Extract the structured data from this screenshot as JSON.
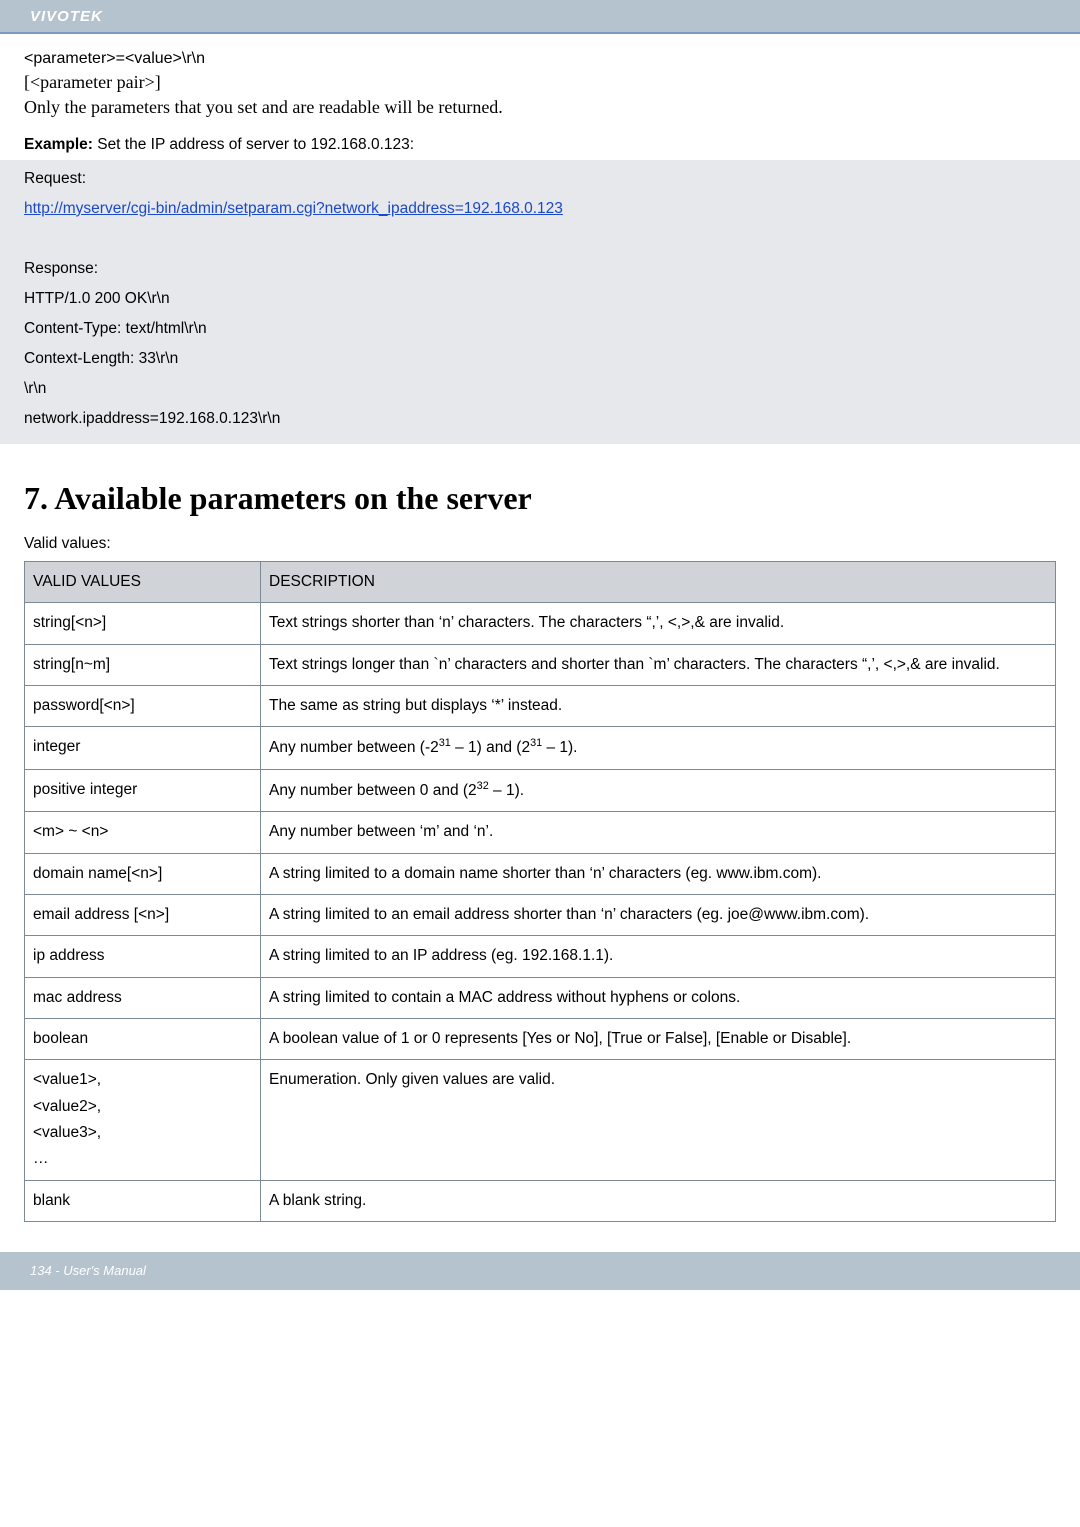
{
  "header": {
    "brand": "VIVOTEK"
  },
  "lead": {
    "l1": "<parameter>=<value>\\r\\n",
    "l2": "[<parameter pair>]",
    "l3": "Only the parameters that you set and are readable will be returned."
  },
  "example": {
    "label_prefix": "Example:",
    "label_rest": " Set the IP address of server to 192.168.0.123:",
    "request_label": "Request:",
    "request_url": "http://myserver/cgi-bin/admin/setparam.cgi?network_ipaddress=192.168.0.123",
    "response_label": "Response:",
    "resp": [
      "HTTP/1.0 200 OK\\r\\n",
      "Content-Type: text/html\\r\\n",
      "Context-Length: 33\\r\\n",
      "\\r\\n",
      "network.ipaddress=192.168.0.123\\r\\n"
    ]
  },
  "section": {
    "heading": "7. Available parameters on the server",
    "valid_values_label": "Valid values:"
  },
  "table": {
    "head_l": "VALID VALUES",
    "head_r": "DESCRIPTION",
    "rows": [
      {
        "l": "string[<n>]",
        "r": "Text strings shorter than ‘n’ characters. The characters “,’, <,>,& are invalid."
      },
      {
        "l": "string[n~m]",
        "r": "Text strings longer than `n’ characters and shorter than `m’ characters. The characters “,’, <,>,& are invalid."
      },
      {
        "l": "password[<n>]",
        "r": "The same as string but displays ‘*’ instead."
      },
      {
        "l": "integer",
        "r_html": "Any number between (-2<sup>31</sup> – 1) and (2<sup>31</sup> – 1)."
      },
      {
        "l": "positive integer",
        "r_html": "Any number between 0 and (2<sup>32</sup> – 1)."
      },
      {
        "l": "<m> ~ <n>",
        "r": "Any number between ‘m’ and ‘n’."
      },
      {
        "l": "domain name[<n>]",
        "r": "A string limited to a domain name shorter than ‘n’ characters (eg. www.ibm.com)."
      },
      {
        "l": "email address [<n>]",
        "r": "A string limited to an email address shorter than ‘n’ characters (eg. joe@www.ibm.com)."
      },
      {
        "l": "ip address",
        "r": "A string limited to an IP address (eg. 192.168.1.1)."
      },
      {
        "l": "mac address",
        "r": "A string limited to contain a MAC address without hyphens or colons."
      },
      {
        "l": "boolean",
        "r": "A boolean value of 1 or 0 represents [Yes or No], [True or False], [Enable or Disable]."
      },
      {
        "l_html": "&lt;value1&gt;,<br>&lt;value2&gt;,<br>&lt;value3&gt;,<br>…",
        "r": "Enumeration. Only given values are valid."
      },
      {
        "l": "blank",
        "r": "A blank string."
      }
    ]
  },
  "footer": {
    "text": "134 - User's Manual"
  }
}
